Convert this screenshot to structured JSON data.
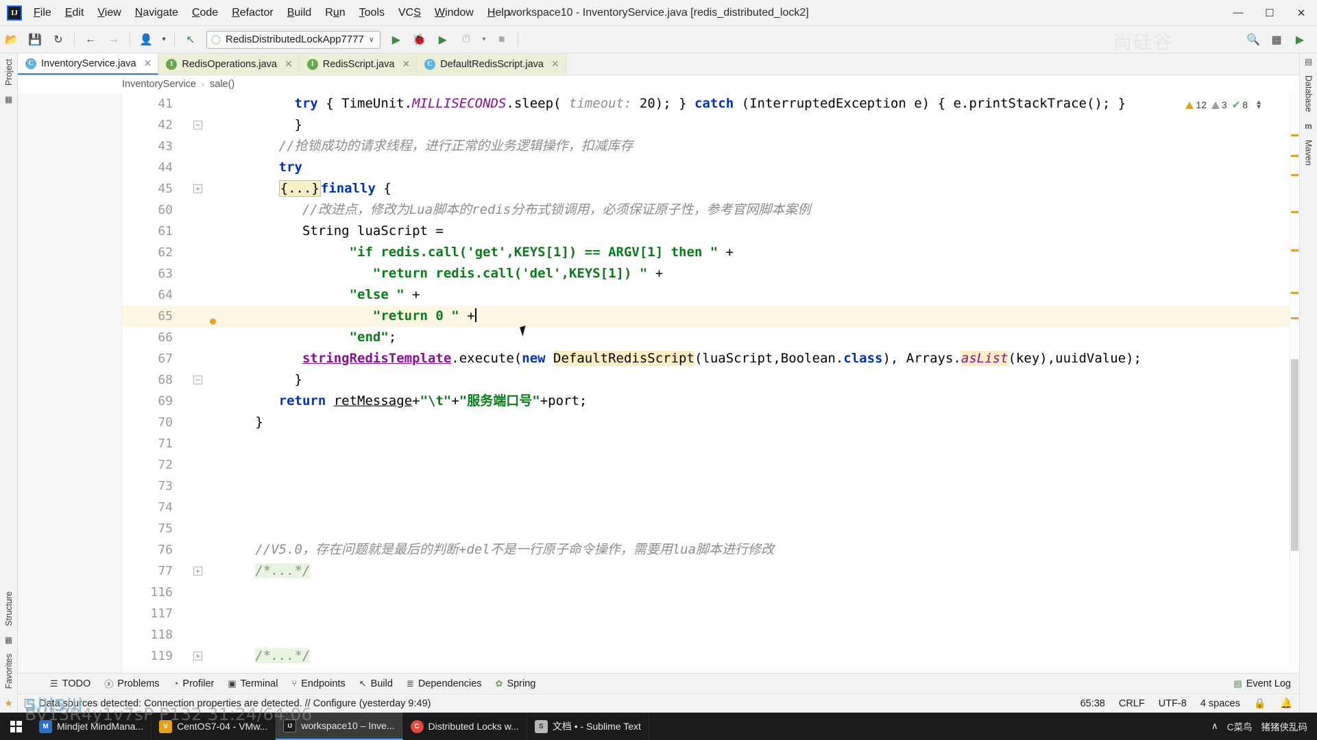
{
  "window": {
    "title": "workspace10 - InventoryService.java [redis_distributed_lock2]",
    "logo": "IJ",
    "minimize": "—",
    "maximize": "☐",
    "close": "✕"
  },
  "menubar": [
    {
      "label": "File",
      "mnemonic": "F"
    },
    {
      "label": "Edit",
      "mnemonic": "E"
    },
    {
      "label": "View",
      "mnemonic": "V"
    },
    {
      "label": "Navigate",
      "mnemonic": "N"
    },
    {
      "label": "Code",
      "mnemonic": "C"
    },
    {
      "label": "Refactor",
      "mnemonic": "R"
    },
    {
      "label": "Build",
      "mnemonic": "B"
    },
    {
      "label": "Run",
      "mnemonic": "u"
    },
    {
      "label": "Tools",
      "mnemonic": "T"
    },
    {
      "label": "VCS",
      "mnemonic": "S"
    },
    {
      "label": "Window",
      "mnemonic": "W"
    },
    {
      "label": "Help",
      "mnemonic": "H"
    }
  ],
  "toolbar": {
    "open_icon": "📂",
    "save_icon": "💾",
    "sync_icon": "↻",
    "back_icon": "←",
    "forward_icon": "→",
    "profile_icon": "👤",
    "profile_caret": "▾",
    "build_icon": "↖",
    "run_config": "RedisDistributedLockApp7777",
    "run_config_caret": "∨",
    "run_icon": "▶",
    "debug_icon": "🐞",
    "run_coverage_icon": "▶",
    "profile_run_icon": "⏱",
    "stop_icon": "■",
    "search_icon": "🔍",
    "layout_icon": "▦",
    "notify_icon": "▶",
    "watermark": "尚硅谷"
  },
  "editor_tabs": [
    {
      "label": "InventoryService.java",
      "kind": "c",
      "badge": "C",
      "active": true,
      "close": "✕"
    },
    {
      "label": "RedisOperations.java",
      "kind": "i",
      "badge": "I",
      "active": false,
      "close": "✕"
    },
    {
      "label": "RedisScript.java",
      "kind": "i",
      "badge": "I",
      "active": false,
      "close": "✕"
    },
    {
      "label": "DefaultRedisScript.java",
      "kind": "c",
      "badge": "C",
      "active": false,
      "close": "✕"
    }
  ],
  "breadcrumb": {
    "class": "InventoryService",
    "separator": "›",
    "method": "sale()"
  },
  "left_rail": {
    "project": "Project",
    "structure": "Structure",
    "favorites": "Favorites",
    "star_icon": "★",
    "grid_icon": "▦"
  },
  "right_rail": {
    "database": "Database",
    "maven": "Maven",
    "db_icon": "▤",
    "m_icon": "m"
  },
  "inspections": {
    "warnings": "12",
    "weak_warnings": "3",
    "checks": "8",
    "check_icon": "✔",
    "up_arrow": "▲",
    "down_arrow": "▼"
  },
  "code_lines": [
    {
      "num": "41",
      "fold": "",
      "bulb": false,
      "hl": false,
      "html": "        <span class=\"kw\">try</span> { TimeUnit.<span class=\"stat\">MILLISECONDS</span>.sleep( <span class=\"cmt\">timeout:</span> <span class=\"pl\">20</span>); } <span class=\"kw\">catch</span> (InterruptedException e) { e.printStackTrace(); }",
      "text": "try { TimeUnit.MILLISECONDS.sleep( timeout: 20); } catch (InterruptedException e) { e.printStackTrace(); }"
    },
    {
      "num": "42",
      "fold": "−",
      "bulb": false,
      "hl": false,
      "html": "        }",
      "text": "}"
    },
    {
      "num": "43",
      "fold": "",
      "bulb": false,
      "hl": false,
      "html": "      <span class=\"cmt\">//抢锁成功的请求线程，进行正常的业务逻辑操作，扣减库存</span>",
      "text": "//抢锁成功的请求线程，进行正常的业务逻辑操作，扣减库存"
    },
    {
      "num": "44",
      "fold": "",
      "bulb": false,
      "hl": false,
      "html": "      <span class=\"kw\">try</span>",
      "text": "try"
    },
    {
      "num": "45",
      "fold": "+",
      "bulb": false,
      "hl": false,
      "html": "      <span class=\"hl-fold\">{...}</span><span class=\"kw\">finally</span> {",
      "text": "{...}finally {"
    },
    {
      "num": "60",
      "fold": "",
      "bulb": false,
      "hl": false,
      "html": "         <span class=\"cmt\">//改进点，修改为Lua脚本的redis分布式锁调用，必须保证原子性，参考官网脚本案例</span>",
      "text": "//改进点，修改为Lua脚本的redis分布式锁调用，必须保证原子性，参考官网脚本案例"
    },
    {
      "num": "61",
      "fold": "",
      "bulb": false,
      "hl": false,
      "html": "         String luaScript =",
      "text": "String luaScript ="
    },
    {
      "num": "62",
      "fold": "",
      "bulb": false,
      "hl": false,
      "html": "               <span class=\"str\">\"if redis.call('get',KEYS[1]) == ARGV[1] then \"</span> +",
      "text": "\"if redis.call('get',KEYS[1]) == ARGV[1] then \" +"
    },
    {
      "num": "63",
      "fold": "",
      "bulb": false,
      "hl": false,
      "html": "                  <span class=\"str\">\"return redis.call('del',KEYS[1]) \"</span> +",
      "text": "\"return redis.call('del',KEYS[1]) \" +"
    },
    {
      "num": "64",
      "fold": "",
      "bulb": false,
      "hl": false,
      "html": "               <span class=\"str\">\"else \"</span> +",
      "text": "\"else \" +"
    },
    {
      "num": "65",
      "fold": "",
      "bulb": true,
      "hl": true,
      "html": "                  <span class=\"str\">\"return 0 \"</span> +<span class=\"caret\"></span>",
      "text": "\"return 0 \" +"
    },
    {
      "num": "66",
      "fold": "",
      "bulb": false,
      "hl": false,
      "html": "               <span class=\"str\">\"end\"</span>;",
      "text": "\"end\";"
    },
    {
      "num": "67",
      "fold": "",
      "bulb": false,
      "hl": false,
      "html": "         <span class=\"fld ulin\">stringRedisTemplate</span>.execute(<span class=\"kw\">new</span> <span class=\"hl-sel\">DefaultRedisScript</span>(luaScript,Boolean.<span class=\"kw\">class</span>), Arrays.<span class=\"stat hl-sel\">asList</span>(key),uuidValue);",
      "text": "stringRedisTemplate.execute(new DefaultRedisScript(luaScript,Boolean.class), Arrays.asList(key),uuidValue);"
    },
    {
      "num": "68",
      "fold": "−",
      "bulb": false,
      "hl": false,
      "html": "        }",
      "text": "}"
    },
    {
      "num": "69",
      "fold": "",
      "bulb": false,
      "hl": false,
      "html": "      <span class=\"kw\">return</span> <span class=\"ulin\">retMessage</span>+<span class=\"str\">\"\\t\"</span>+<span class=\"str\">\"服务端口号\"</span>+port;",
      "text": "return retMessage+\"\\t\"+\"服务端口号\"+port;"
    },
    {
      "num": "70",
      "fold": "",
      "bulb": false,
      "hl": false,
      "html": "   }",
      "text": "}"
    },
    {
      "num": "71",
      "fold": "",
      "bulb": false,
      "hl": false,
      "html": "",
      "text": ""
    },
    {
      "num": "72",
      "fold": "",
      "bulb": false,
      "hl": false,
      "html": "",
      "text": ""
    },
    {
      "num": "73",
      "fold": "",
      "bulb": false,
      "hl": false,
      "html": "",
      "text": ""
    },
    {
      "num": "74",
      "fold": "",
      "bulb": false,
      "hl": false,
      "html": "",
      "text": ""
    },
    {
      "num": "75",
      "fold": "",
      "bulb": false,
      "hl": false,
      "html": "",
      "text": ""
    },
    {
      "num": "76",
      "fold": "",
      "bulb": false,
      "hl": false,
      "html": "   <span class=\"cmt\">//V5.0，存在问题就是最后的判断+del不是一行原子命令操作，需要用lua脚本进行修改</span>",
      "text": "//V5.0，存在问题就是最后的判断+del不是一行原子命令操作，需要用lua脚本进行修改"
    },
    {
      "num": "77",
      "fold": "+",
      "bulb": false,
      "hl": false,
      "html": "   <span class=\"cmt hl-green\">/*...*/</span>",
      "text": "/*...*/"
    },
    {
      "num": "116",
      "fold": "",
      "bulb": false,
      "hl": false,
      "html": "",
      "text": ""
    },
    {
      "num": "117",
      "fold": "",
      "bulb": false,
      "hl": false,
      "html": "",
      "text": ""
    },
    {
      "num": "118",
      "fold": "",
      "bulb": false,
      "hl": false,
      "html": "",
      "text": ""
    },
    {
      "num": "119",
      "fold": "+",
      "bulb": false,
      "hl": false,
      "html": "   <span class=\"cmt hl-green\">/*...*/</span>",
      "text": "/*...*/"
    }
  ],
  "toolwindow_bar": {
    "items": [
      {
        "label": "TODO",
        "icon": "☰"
      },
      {
        "label": "Problems",
        "icon": "ⓧ"
      },
      {
        "label": "Profiler",
        "icon": "◔"
      },
      {
        "label": "Terminal",
        "icon": "▣"
      },
      {
        "label": "Endpoints",
        "icon": "⑂"
      },
      {
        "label": "Build",
        "icon": "↖"
      },
      {
        "label": "Dependencies",
        "icon": "≣"
      },
      {
        "label": "Spring",
        "icon": "✿"
      }
    ],
    "event_log": "Event Log",
    "event_log_icon": "▤"
  },
  "statusbar": {
    "message": "Data sources detected: Connection properties are detected. // Configure (yesterday 9:49)",
    "position": "65:38",
    "line_sep": "CRLF",
    "encoding": "UTF-8",
    "indent": "4 spaces",
    "lock_icon": "🔒",
    "bell_icon": "🔔"
  },
  "taskbar": {
    "buttons": [
      {
        "label": "Mindjet MindMana...",
        "badge": "M",
        "color": "#2a6fc9",
        "active": false
      },
      {
        "label": "CentOS7-04 - VMw...",
        "badge": "V",
        "color": "#e8a117",
        "active": false
      },
      {
        "label": "workspace10 – Inve...",
        "badge": "IJ",
        "color": "#1b1b1b",
        "active": true
      },
      {
        "label": "Distributed Locks w...",
        "badge": "C",
        "color": "#e8483b",
        "active": false
      },
      {
        "label": "文档 • - Sublime Text",
        "badge": "S",
        "color": "#b8b8b8",
        "active": false
      }
    ],
    "tray_caret": "∧",
    "tray_text": "C菜鸟",
    "tray_text2": "猪猪侠乱码",
    "overlay": "BV13R4y1v7sP P132  31:24/64:06",
    "overlay2": "5川5川"
  }
}
